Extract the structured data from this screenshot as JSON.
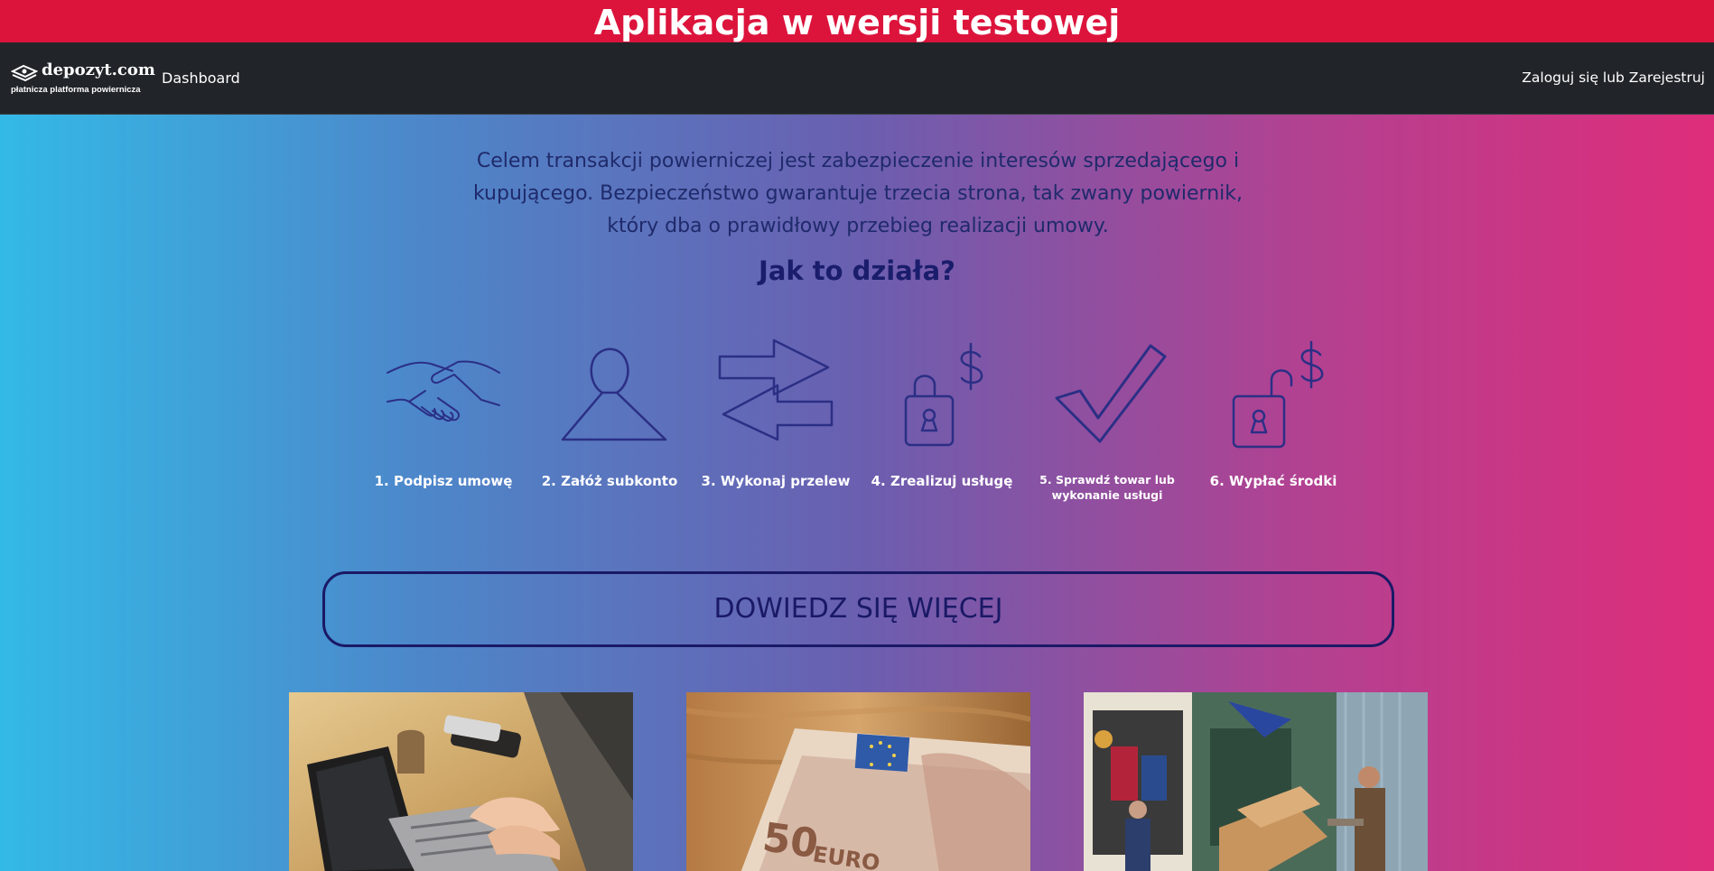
{
  "banner": {
    "text": "Aplikacja w wersji testowej"
  },
  "navbar": {
    "brand_name": "depozyt.com",
    "brand_tagline": "płatnicza platforma powiernicza",
    "links": [
      {
        "label": "Dashboard"
      }
    ],
    "auth_label": "Zaloguj się lub Zarejestruj"
  },
  "hero": {
    "intro": "Celem transakcji powierniczej jest zabezpieczenie interesów sprzedającego i kupującego. Bezpieczeństwo gwarantuje trzecia strona, tak zwany powiernik, który dba o prawidłowy przebieg realizacji umowy.",
    "how_title": "Jak to działa?",
    "steps": [
      {
        "label": "1. Podpisz umowę",
        "icon": "handshake-icon"
      },
      {
        "label": "2. Załóż subkonto",
        "icon": "user-icon"
      },
      {
        "label": "3. Wykonaj przelew",
        "icon": "transfer-arrows-icon"
      },
      {
        "label": "4. Zrealizuj usługę",
        "icon": "locked-padlock-dollar-icon"
      },
      {
        "label": "5. Sprawdź towar lub wykonanie usługi",
        "icon": "checkmark-icon"
      },
      {
        "label": "6. Wypłać środki",
        "icon": "unlocked-padlock-dollar-icon"
      }
    ],
    "more_button": "DOWIEDZ SIĘ WIĘCEJ",
    "photos": [
      {
        "subject": "laptop typing photo"
      },
      {
        "subject": "50 euro banknote photo"
      },
      {
        "subject": "delivery shop photo"
      }
    ]
  },
  "colors": {
    "banner": "#dc143c",
    "navbar": "#212529",
    "gradient_left": "#33b9e6",
    "gradient_right": "#de2d7a",
    "dark_navy": "#1a1966"
  }
}
